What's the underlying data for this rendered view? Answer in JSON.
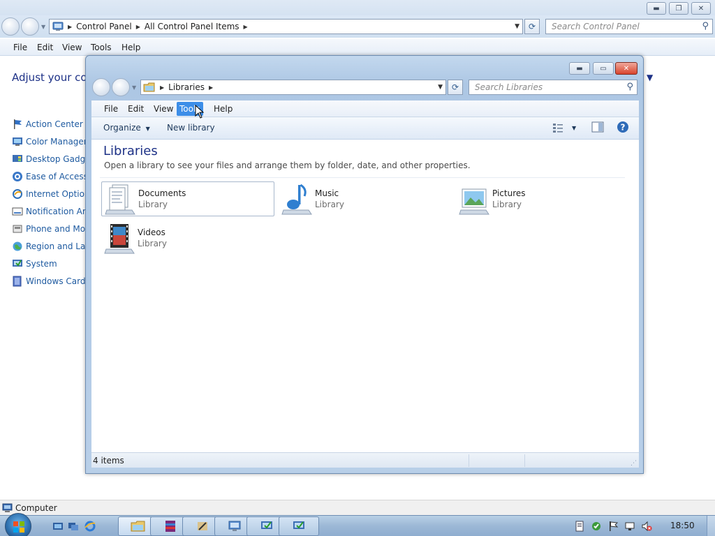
{
  "control_panel": {
    "breadcrumb": [
      "Control Panel",
      "All Control Panel Items"
    ],
    "search_placeholder": "Search Control Panel",
    "menu": [
      "File",
      "Edit",
      "View",
      "Tools",
      "Help"
    ],
    "adjust_text": "Adjust your co",
    "items": [
      {
        "label": "Action Center",
        "icon": "flag-icon"
      },
      {
        "label": "Color Managem",
        "icon": "color-management-icon"
      },
      {
        "label": "Desktop Gadget",
        "icon": "gadgets-icon"
      },
      {
        "label": "Ease of Access C",
        "icon": "ease-of-access-icon"
      },
      {
        "label": "Internet Options",
        "icon": "internet-options-icon"
      },
      {
        "label": "Notification Are",
        "icon": "notification-area-icon"
      },
      {
        "label": "Phone and Mod",
        "icon": "phone-modem-icon"
      },
      {
        "label": "Region and Lang",
        "icon": "region-language-icon"
      },
      {
        "label": "System",
        "icon": "system-icon"
      },
      {
        "label": "Windows CardSp",
        "icon": "cardspace-icon"
      }
    ],
    "status_label": "Computer"
  },
  "libraries": {
    "breadcrumb": [
      "Libraries"
    ],
    "search_placeholder": "Search Libraries",
    "menu": [
      "File",
      "Edit",
      "View",
      "Tools",
      "Help"
    ],
    "highlighted_menu": "Tools",
    "commands": {
      "organize": "Organize",
      "new_library": "New library"
    },
    "title": "Libraries",
    "subtitle": "Open a library to see your files and arrange them by folder, date, and other properties.",
    "tiles": [
      {
        "name": "Documents",
        "type": "Library",
        "icon": "documents-library-icon",
        "selected": true
      },
      {
        "name": "Music",
        "type": "Library",
        "icon": "music-library-icon",
        "selected": false
      },
      {
        "name": "Pictures",
        "type": "Library",
        "icon": "pictures-library-icon",
        "selected": false
      },
      {
        "name": "Videos",
        "type": "Library",
        "icon": "videos-library-icon",
        "selected": false
      }
    ],
    "status": "4 items"
  },
  "taskbar": {
    "clock": "18:50"
  },
  "colors": {
    "accent": "#3d8ee8",
    "link": "#1e5aa0",
    "heading": "#1e3287"
  }
}
